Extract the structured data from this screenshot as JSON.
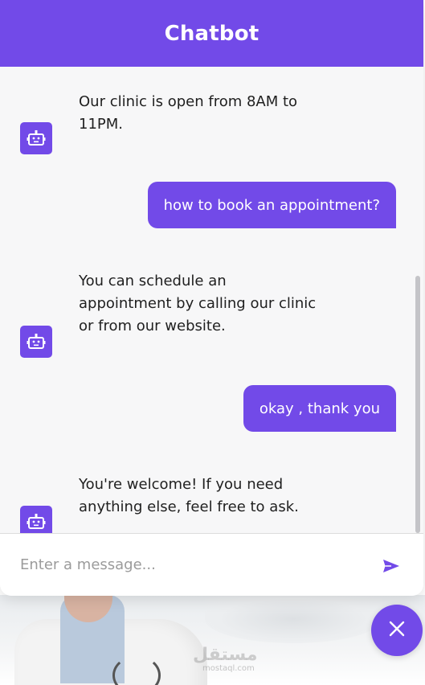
{
  "header": {
    "title": "Chatbot"
  },
  "messages": [
    {
      "type": "incoming",
      "text": "Our clinic is open from 8AM to 11PM."
    },
    {
      "type": "outgoing",
      "text": "how to book an appointment?"
    },
    {
      "type": "incoming",
      "text": "You can schedule an appointment by calling our clinic or from our website."
    },
    {
      "type": "outgoing",
      "text": "okay , thank you"
    },
    {
      "type": "incoming",
      "text": "You're welcome! If you need anything else, feel free to ask."
    }
  ],
  "input": {
    "placeholder": "Enter a message..."
  },
  "icons": {
    "bot": "robot-icon",
    "send": "send-icon",
    "close": "close-icon"
  },
  "colors": {
    "accent": "#724ae8",
    "background": "#f7f7f8"
  },
  "watermark": {
    "text": "مستقل",
    "sub": "mostaql.com"
  }
}
